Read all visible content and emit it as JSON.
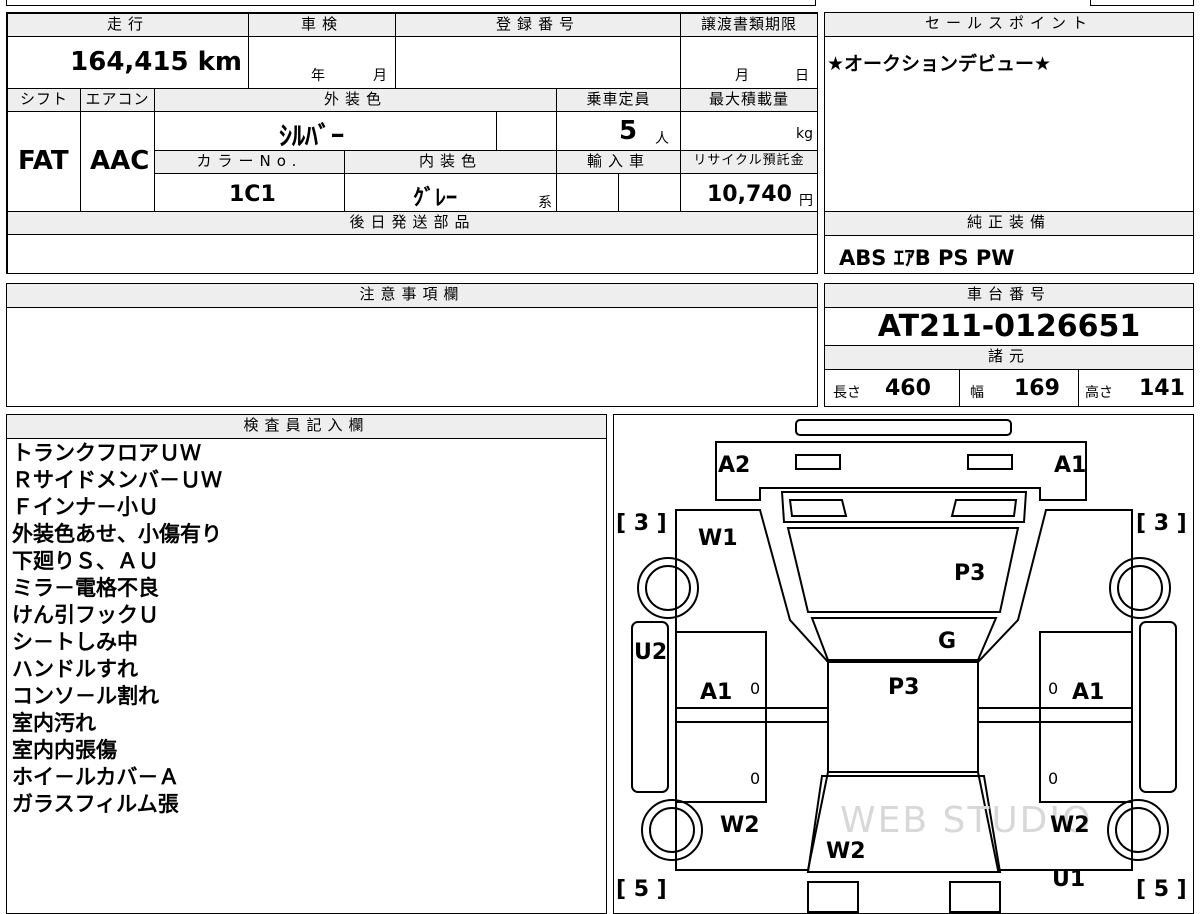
{
  "vehicle": {
    "mileage_label": "走行",
    "mileage_value": "164,415 km",
    "inspection_label": "車検",
    "inspection_year_unit": "年",
    "inspection_month_unit": "月",
    "registration_label": "登録番号",
    "transfer_deadline_label": "譲渡書類期限",
    "transfer_month_unit": "月",
    "transfer_day_unit": "日",
    "shift_label": "シフト",
    "shift_value": "FAT",
    "aircon_label": "エアコン",
    "aircon_value": "AAC",
    "exterior_color_label": "外装色",
    "exterior_color_value": "ｼﾙﾊﾞｰ",
    "capacity_label": "乗車定員",
    "capacity_value": "5",
    "capacity_unit": "人",
    "max_load_label": "最大積載量",
    "max_load_unit": "kg",
    "color_no_label": "カラーNo.",
    "color_no_value": "1C1",
    "interior_color_label": "内装色",
    "interior_color_value": "ｸﾞﾚｰ",
    "interior_color_suffix": "系",
    "import_label": "輸入車",
    "recycle_label": "リサイクル預託金",
    "recycle_value": "10,740",
    "recycle_unit": "円",
    "later_parts_label": "後日発送部品"
  },
  "sales_point": {
    "label": "セールスポイント",
    "text": "★オークションデビュー★"
  },
  "genuine_equipment": {
    "label": "純正装備",
    "text": "ABS ｴｱB PS PW"
  },
  "notes": {
    "label": "注意事項欄"
  },
  "chassis": {
    "label": "車台番号",
    "value": "AT211-0126651"
  },
  "specs": {
    "label": "諸元",
    "length_label": "長さ",
    "length_value": "460",
    "width_label": "幅",
    "width_value": "169",
    "height_label": "高さ",
    "height_value": "141"
  },
  "inspector": {
    "label": "検査員記入欄",
    "items": [
      "トランクフロアＵＷ",
      "Ｒサイドメンバ－ＵＷ",
      "Ｆインナ－小Ｕ",
      "外装色あせ、小傷有り",
      "下廻りＳ、ＡＵ",
      "ミラ－電格不良",
      "けん引フックＵ",
      "シ－トしみ中",
      "ハンドルすれ",
      "コンソ－ル割れ",
      "室内汚れ",
      "室内内張傷",
      "ホイ－ルカバ－Ａ",
      "ガラスフィルム張"
    ]
  },
  "diagram": {
    "marks": {
      "a2": "A2",
      "a1_rear_right": "A1",
      "w1": "W1",
      "p3_roof": "P3",
      "u2": "U2",
      "g": "G",
      "a1_left_door": "A1",
      "a1_right_door": "A1",
      "p3_bonnet": "P3",
      "w2_left": "W2",
      "w2_right": "W2",
      "w2_front": "W2",
      "u1": "U1",
      "zero_1": "0",
      "zero_2": "0",
      "zero_3": "0",
      "zero_4": "0"
    },
    "tire_tl": "[ 3 ]",
    "tire_tr": "[ 3 ]",
    "tire_bl": "[ 5 ]",
    "tire_br": "[ 5 ]",
    "watermark": "WEB STUDIO"
  }
}
